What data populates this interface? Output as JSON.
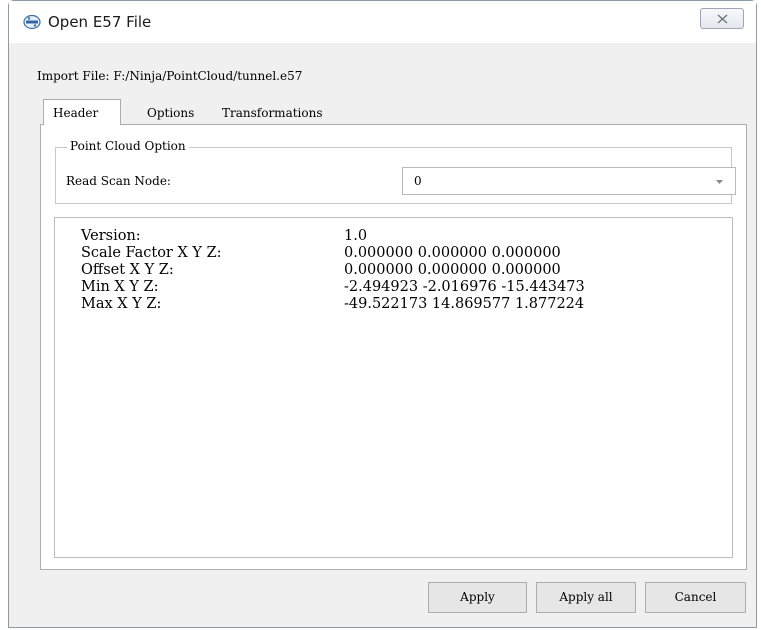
{
  "window": {
    "title": "Open E57 File",
    "close_icon": "close-icon"
  },
  "import_file": {
    "text": "Import File: F:/Ninja/PointCloud/tunnel.e57"
  },
  "tabs": [
    {
      "label": "Header",
      "selected": true
    },
    {
      "label": "Options",
      "selected": false
    },
    {
      "label": "Transformations",
      "selected": false
    }
  ],
  "point_cloud_option": {
    "group_title": "Point Cloud Option",
    "read_scan_node_label": "Read Scan Node:",
    "read_scan_node_value": "0"
  },
  "header_info": {
    "rows": [
      {
        "label": "Version:",
        "value": "1.0"
      },
      {
        "label": "Scale Factor X Y Z:",
        "value": "0.000000 0.000000 0.000000"
      },
      {
        "label": "Offset X Y Z:",
        "value": "0.000000 0.000000 0.000000"
      },
      {
        "label": "Min X Y Z:",
        "value": "-2.494923 -2.016976 -15.443473"
      },
      {
        "label": "Max X Y Z:",
        "value": "-49.522173 14.869577 1.877224"
      }
    ]
  },
  "buttons": {
    "apply": "Apply",
    "apply_all": "Apply all",
    "cancel": "Cancel"
  }
}
